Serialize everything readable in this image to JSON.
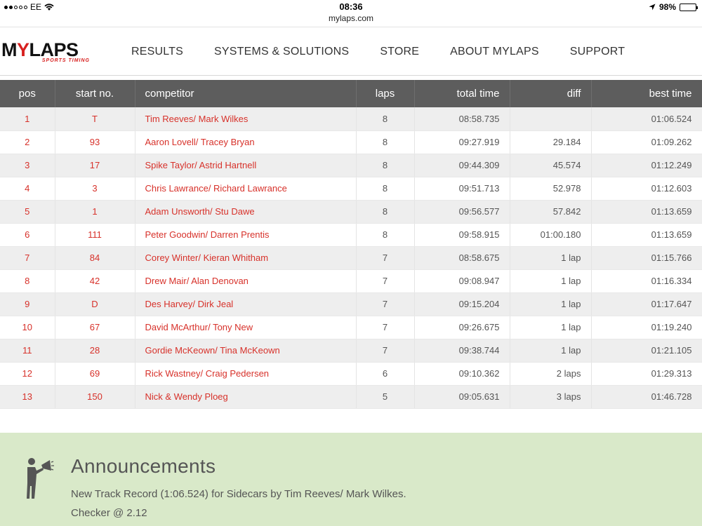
{
  "status_bar": {
    "carrier": "EE",
    "time": "08:36",
    "battery": "98%"
  },
  "url": "mylaps.com",
  "logo": {
    "text_pre": "M",
    "text_y": "Y",
    "text_post": "LAPS",
    "tagline": "SPORTS TIMING"
  },
  "nav": [
    "RESULTS",
    "SYSTEMS & SOLUTIONS",
    "STORE",
    "ABOUT MYLAPS",
    "SUPPORT"
  ],
  "table": {
    "headers": [
      "pos",
      "start no.",
      "competitor",
      "laps",
      "total time",
      "diff",
      "best time"
    ],
    "rows": [
      [
        "1",
        "T",
        "Tim Reeves/ Mark Wilkes",
        "8",
        "08:58.735",
        "",
        "01:06.524"
      ],
      [
        "2",
        "93",
        "Aaron Lovell/ Tracey Bryan",
        "8",
        "09:27.919",
        "29.184",
        "01:09.262"
      ],
      [
        "3",
        "17",
        "Spike Taylor/ Astrid Hartnell",
        "8",
        "09:44.309",
        "45.574",
        "01:12.249"
      ],
      [
        "4",
        "3",
        "Chris Lawrance/ Richard Lawrance",
        "8",
        "09:51.713",
        "52.978",
        "01:12.603"
      ],
      [
        "5",
        "1",
        "Adam Unsworth/ Stu Dawe",
        "8",
        "09:56.577",
        "57.842",
        "01:13.659"
      ],
      [
        "6",
        "111",
        "Peter Goodwin/ Darren Prentis",
        "8",
        "09:58.915",
        "01:00.180",
        "01:13.659"
      ],
      [
        "7",
        "84",
        "Corey Winter/ Kieran Whitham",
        "7",
        "08:58.675",
        "1 lap",
        "01:15.766"
      ],
      [
        "8",
        "42",
        "Drew Mair/ Alan Denovan",
        "7",
        "09:08.947",
        "1 lap",
        "01:16.334"
      ],
      [
        "9",
        "D",
        "Des Harvey/ Dirk Jeal",
        "7",
        "09:15.204",
        "1 lap",
        "01:17.647"
      ],
      [
        "10",
        "67",
        "David McArthur/ Tony New",
        "7",
        "09:26.675",
        "1 lap",
        "01:19.240"
      ],
      [
        "11",
        "28",
        "Gordie McKeown/ Tina McKeown",
        "7",
        "09:38.744",
        "1 lap",
        "01:21.105"
      ],
      [
        "12",
        "69",
        "Rick Wastney/ Craig Pedersen",
        "6",
        "09:10.362",
        "2 laps",
        "01:29.313"
      ],
      [
        "13",
        "150",
        "Nick & Wendy Ploeg",
        "5",
        "09:05.631",
        "3 laps",
        "01:46.728"
      ]
    ]
  },
  "announcements": {
    "title": "Announcements",
    "lines": [
      "New Track Record (1:06.524) for Sidecars by Tim Reeves/ Mark Wilkes.",
      "Checker @ 2.12"
    ]
  },
  "colors": {
    "accent_red": "#d7312a",
    "header_gray": "#5d5d5d",
    "announcement_bg": "#d9e9c9"
  }
}
